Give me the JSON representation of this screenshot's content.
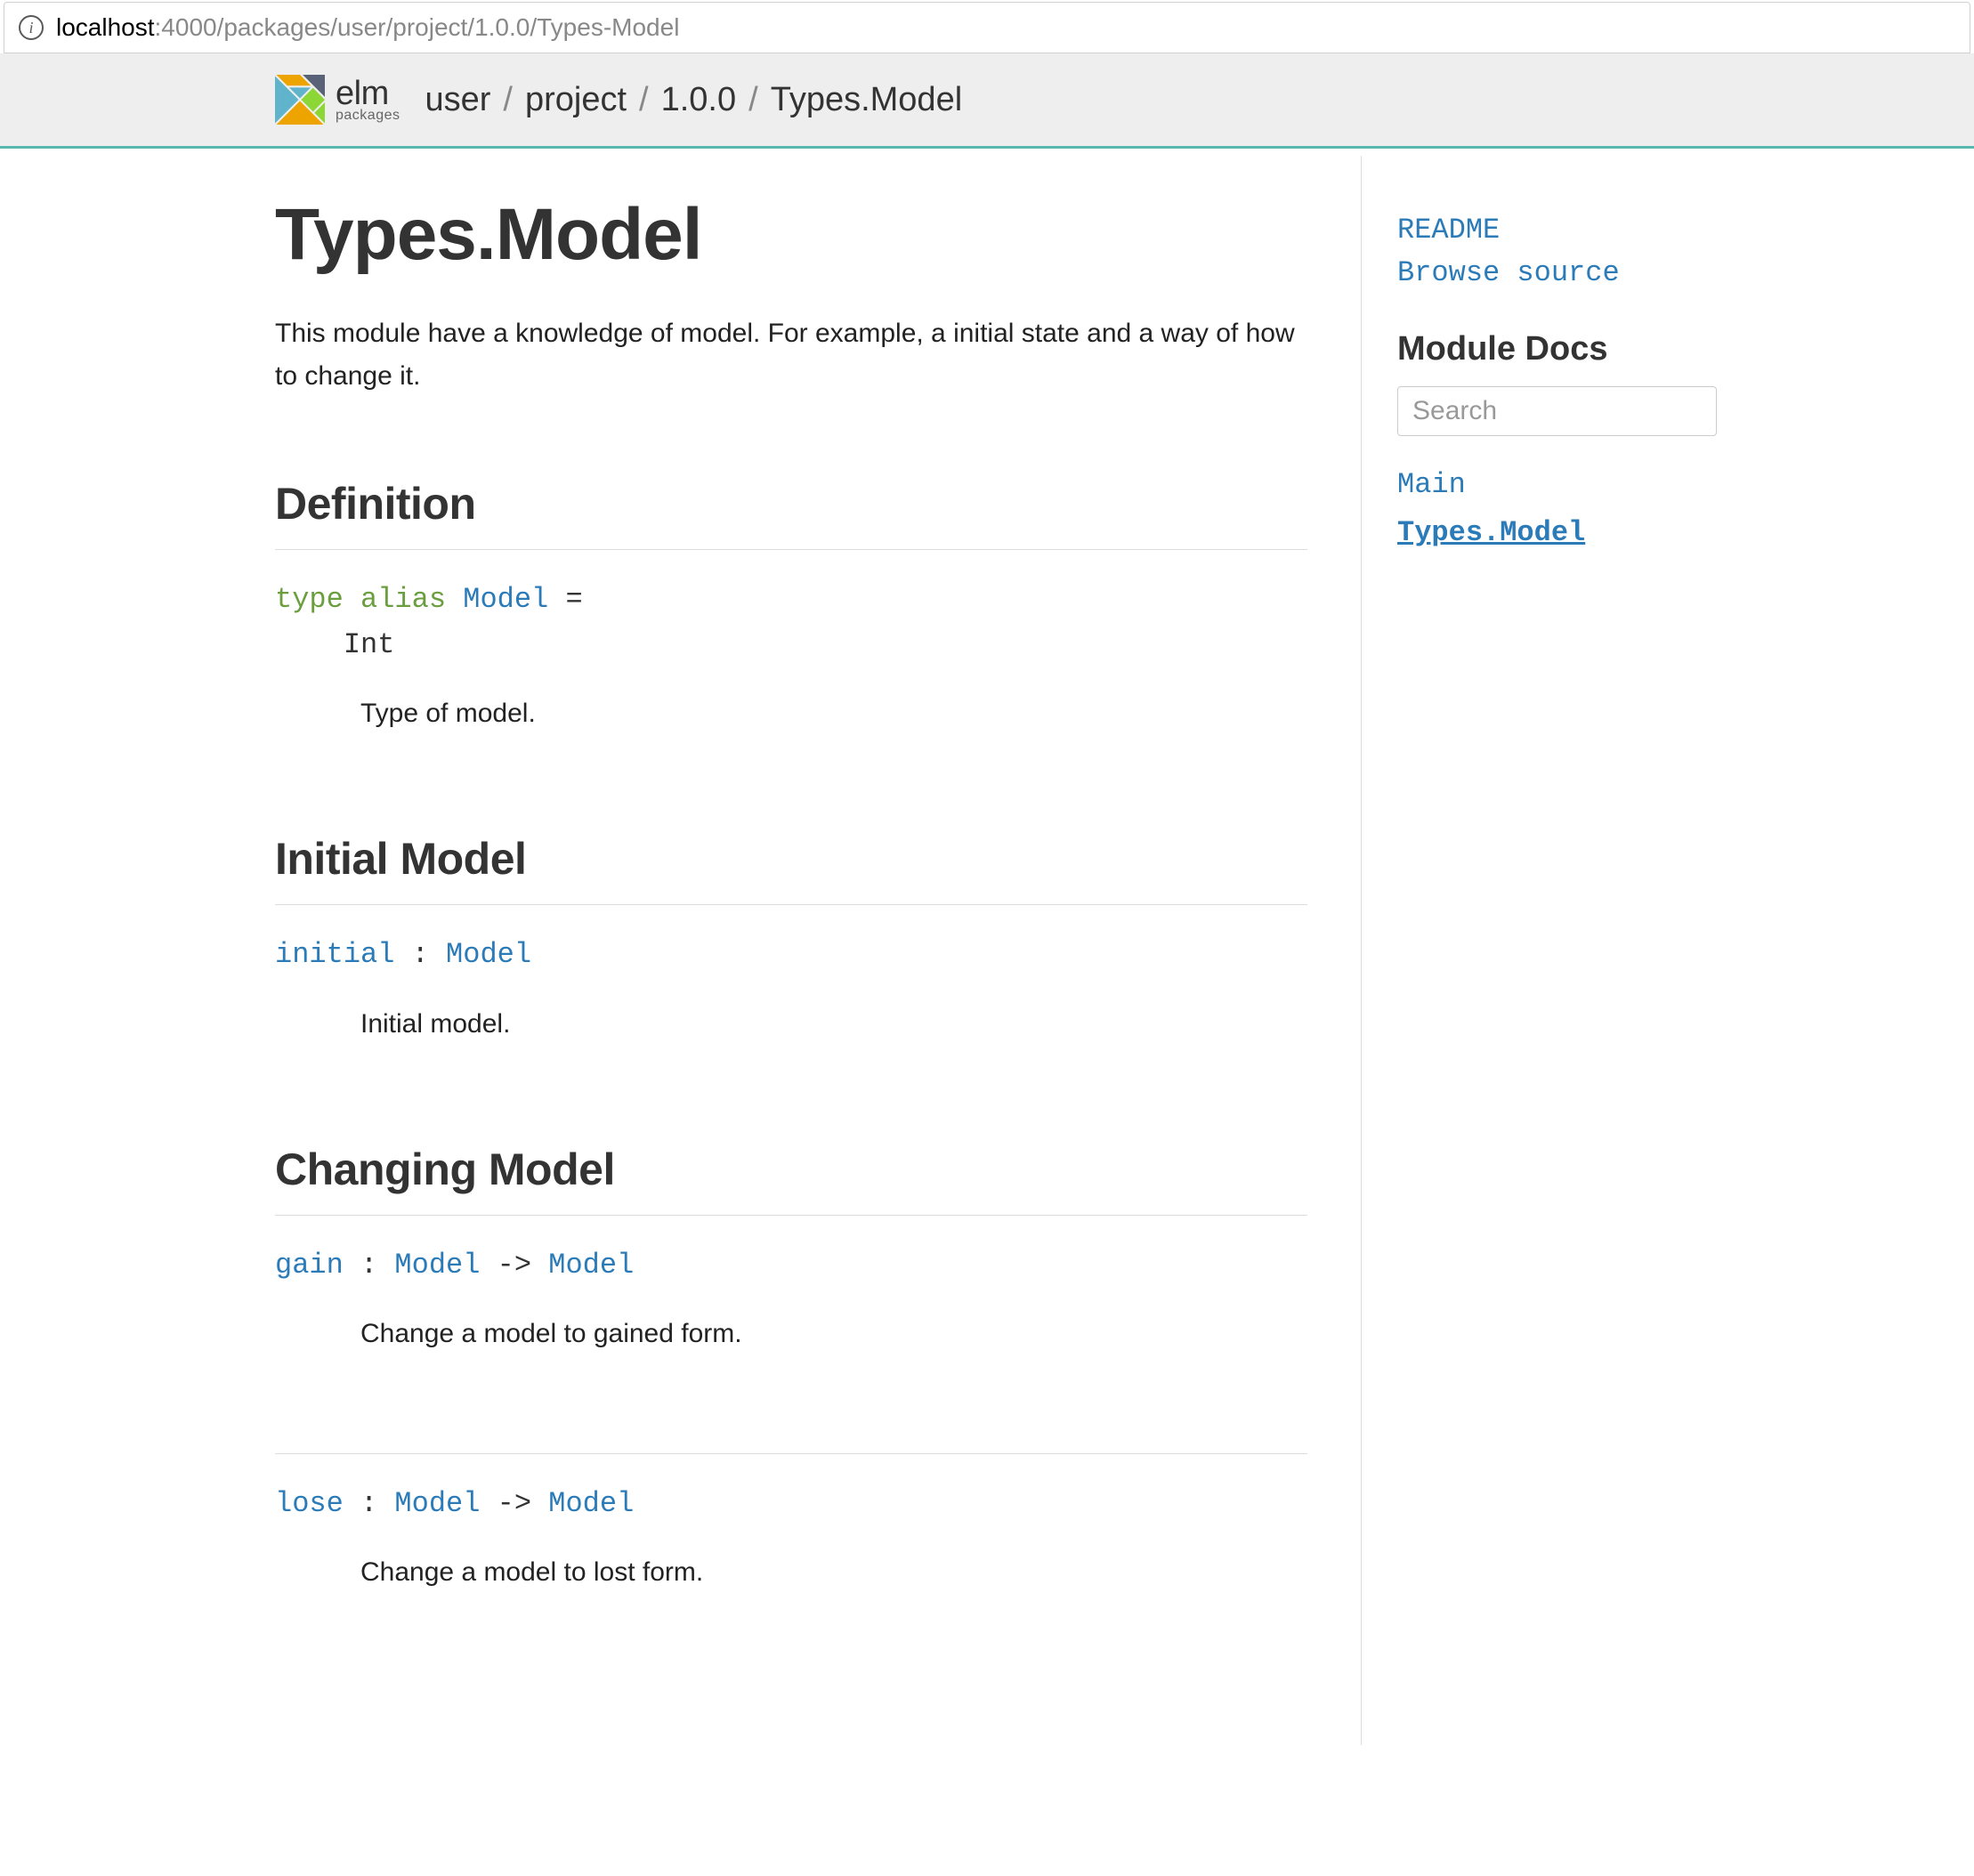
{
  "address": {
    "host": "localhost",
    "rest": ":4000/packages/user/project/1.0.0/Types-Model"
  },
  "header": {
    "logo_main": "elm",
    "logo_sub": "packages",
    "crumbs": [
      "user",
      "project",
      "1.0.0",
      "Types.Model"
    ]
  },
  "main": {
    "title": "Types.Model",
    "description": "This module have a knowledge of model. For example, a initial state and a way of how to change it.",
    "sections": [
      {
        "heading": "Definition",
        "sig_parts": [
          {
            "text": "type alias ",
            "cls": "kw-green"
          },
          {
            "text": "Model",
            "cls": "kw-blue"
          },
          {
            "text": " =",
            "cls": "kw-plain"
          },
          {
            "text": "\n    Int",
            "cls": "kw-plain"
          }
        ],
        "doc": "Type of model."
      },
      {
        "heading": "Initial Model",
        "sig_parts": [
          {
            "text": "initial",
            "cls": "kw-blue"
          },
          {
            "text": " : ",
            "cls": "kw-plain"
          },
          {
            "text": "Model",
            "cls": "kw-blue"
          }
        ],
        "doc": "Initial model."
      },
      {
        "heading": "Changing Model",
        "sig_parts": [
          {
            "text": "gain",
            "cls": "kw-blue"
          },
          {
            "text": " : ",
            "cls": "kw-plain"
          },
          {
            "text": "Model",
            "cls": "kw-blue"
          },
          {
            "text": " -> ",
            "cls": "kw-plain"
          },
          {
            "text": "Model",
            "cls": "kw-blue"
          }
        ],
        "doc": "Change a model to gained form."
      },
      {
        "heading": "",
        "sig_parts": [
          {
            "text": "lose",
            "cls": "kw-blue"
          },
          {
            "text": " : ",
            "cls": "kw-plain"
          },
          {
            "text": "Model",
            "cls": "kw-blue"
          },
          {
            "text": " -> ",
            "cls": "kw-plain"
          },
          {
            "text": "Model",
            "cls": "kw-blue"
          }
        ],
        "doc": "Change a model to lost form."
      }
    ]
  },
  "sidebar": {
    "links": [
      "README",
      "Browse source"
    ],
    "heading": "Module Docs",
    "search_placeholder": "Search",
    "modules": [
      {
        "name": "Main",
        "active": false
      },
      {
        "name": "Types.Model",
        "active": true
      }
    ]
  }
}
